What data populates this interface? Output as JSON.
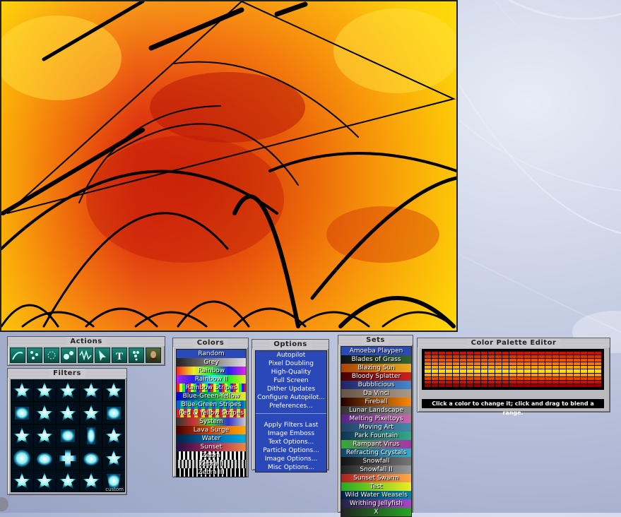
{
  "actions": {
    "title": "Actions",
    "icons": [
      "flow-icon",
      "scatter-icon",
      "particles-icon",
      "bubbles-icon",
      "wave-icon",
      "cursor-icon",
      "text-icon",
      "grapes-icon",
      "portrait-icon"
    ]
  },
  "filters": {
    "title": "Filters",
    "custom_label": "custom"
  },
  "colors": {
    "title": "Colors",
    "items": [
      {
        "label": "Random",
        "bg": "#2a4ab8"
      },
      {
        "label": "Grey",
        "bg": "linear-gradient(90deg,#222,#ddd)"
      },
      {
        "label": "Rainbow",
        "bg": "linear-gradient(90deg,#e22,#ee2,#2e2,#22e,#e2e)"
      },
      {
        "label": "Rainbow II",
        "bg": "linear-gradient(90deg,#a2e,#22e,#2ee,#2e2,#ee2)"
      },
      {
        "label": "Rainbow Stripes",
        "bg": "repeating-linear-gradient(90deg,#e22 0 4px,#ee2 4px 8px,#2e2 8px 12px,#22e 12px 16px)"
      },
      {
        "label": "Blue-Green-Yellow",
        "bg": "linear-gradient(90deg,#00c,#0a4,#ee2)"
      },
      {
        "label": "Blue-Green Stripes",
        "bg": "repeating-linear-gradient(90deg,#06c 0 5px,#0a6 5px 10px)"
      },
      {
        "label": "Red & Yellow Stripes",
        "bg": "repeating-linear-gradient(90deg,#c22 0 5px,#dd2 5px 10px)"
      },
      {
        "label": "System",
        "bg": "linear-gradient(90deg,#333,#c33,#3c3,#33c,#ccc)"
      },
      {
        "label": "Lava Surge",
        "bg": "linear-gradient(90deg,#400,#d40,#fa0)"
      },
      {
        "label": "Water",
        "bg": "linear-gradient(90deg,#024,#06a,#0ad)"
      },
      {
        "label": "Sunset",
        "bg": "linear-gradient(90deg,#214,#a25,#e84)"
      },
      {
        "label": "Zebra",
        "bg": "repeating-linear-gradient(90deg,#000 0 3px,#eee 3px 6px)"
      },
      {
        "label": "Zebra II",
        "bg": "repeating-linear-gradient(90deg,#111 0 2px,#ccc 2px 5px)"
      },
      {
        "label": "Zebra III",
        "bg": "repeating-linear-gradient(90deg,#000 0 4px,#ddd 4px 6px)"
      }
    ]
  },
  "options": {
    "title": "Options",
    "group1": [
      "Autopilot",
      "Pixel Doubling",
      "High-Quality",
      "Full Screen",
      "Dither Updates",
      "Configure Autopilot...",
      "Preferences..."
    ],
    "group2": [
      "Apply Filters Last",
      "Image Emboss",
      "Text Options...",
      "Particle Options...",
      "Image Options...",
      "Misc Options..."
    ]
  },
  "sets": {
    "title": "Sets",
    "items": [
      {
        "label": "Amoeba Playpen",
        "bg": "#2a4ab8"
      },
      {
        "label": "Blades of Grass",
        "bg": "linear-gradient(90deg,#111,#363)"
      },
      {
        "label": "Blazing Sun",
        "bg": "linear-gradient(90deg,#a40,#ea2)"
      },
      {
        "label": "Bloody Splatter",
        "bg": "linear-gradient(90deg,#400,#c22)"
      },
      {
        "label": "Bubblicious",
        "bg": "linear-gradient(90deg,#226,#48c)"
      },
      {
        "label": "Da Vinci",
        "bg": "linear-gradient(90deg,#654,#a98)"
      },
      {
        "label": "Fireball",
        "bg": "linear-gradient(90deg,#200,#f80)"
      },
      {
        "label": "Lunar Landscape",
        "bg": "linear-gradient(90deg,#333,#888)"
      },
      {
        "label": "Melting Pixeltoys",
        "bg": "linear-gradient(90deg,#528,#c6a)"
      },
      {
        "label": "Moving Art",
        "bg": "linear-gradient(90deg,#246,#48a)"
      },
      {
        "label": "Park Fountain",
        "bg": "linear-gradient(90deg,#135,#3a8)"
      },
      {
        "label": "Rampant Virus",
        "bg": "linear-gradient(90deg,#3a3,#a3a)"
      },
      {
        "label": "Refracting Crystals",
        "bg": "linear-gradient(90deg,#146,#3ac)"
      },
      {
        "label": "Snowfall",
        "bg": "linear-gradient(90deg,#111,#777)"
      },
      {
        "label": "Snowfall II",
        "bg": "linear-gradient(90deg,#222,#999)"
      },
      {
        "label": "Sunset Swarm",
        "bg": "linear-gradient(90deg,#a22,#fa4)"
      },
      {
        "label": "Test",
        "bg": "linear-gradient(90deg,#2a2,#ee2)"
      },
      {
        "label": "Wild Water Weasels",
        "bg": "linear-gradient(90deg,#024,#08a)"
      },
      {
        "label": "Writhing Jellyfish",
        "bg": "linear-gradient(90deg,#224,#a4c)"
      },
      {
        "label": "X",
        "bg": "linear-gradient(90deg,#222,#2a2)"
      }
    ]
  },
  "palette": {
    "title": "Color Palette Editor",
    "note": "Click a color to change it; click and drag to blend a range.",
    "rows": [
      "#cc1100",
      "#dd3300",
      "#ee5500",
      "#ff7700",
      "#ffaa00",
      "#ffdd00",
      "#ff9900",
      "#ee4400",
      "#cc1100",
      "#990000"
    ]
  },
  "colors_hex": {
    "panel_bg": "#b9b9c0",
    "list_blue": "#2a48b8"
  }
}
